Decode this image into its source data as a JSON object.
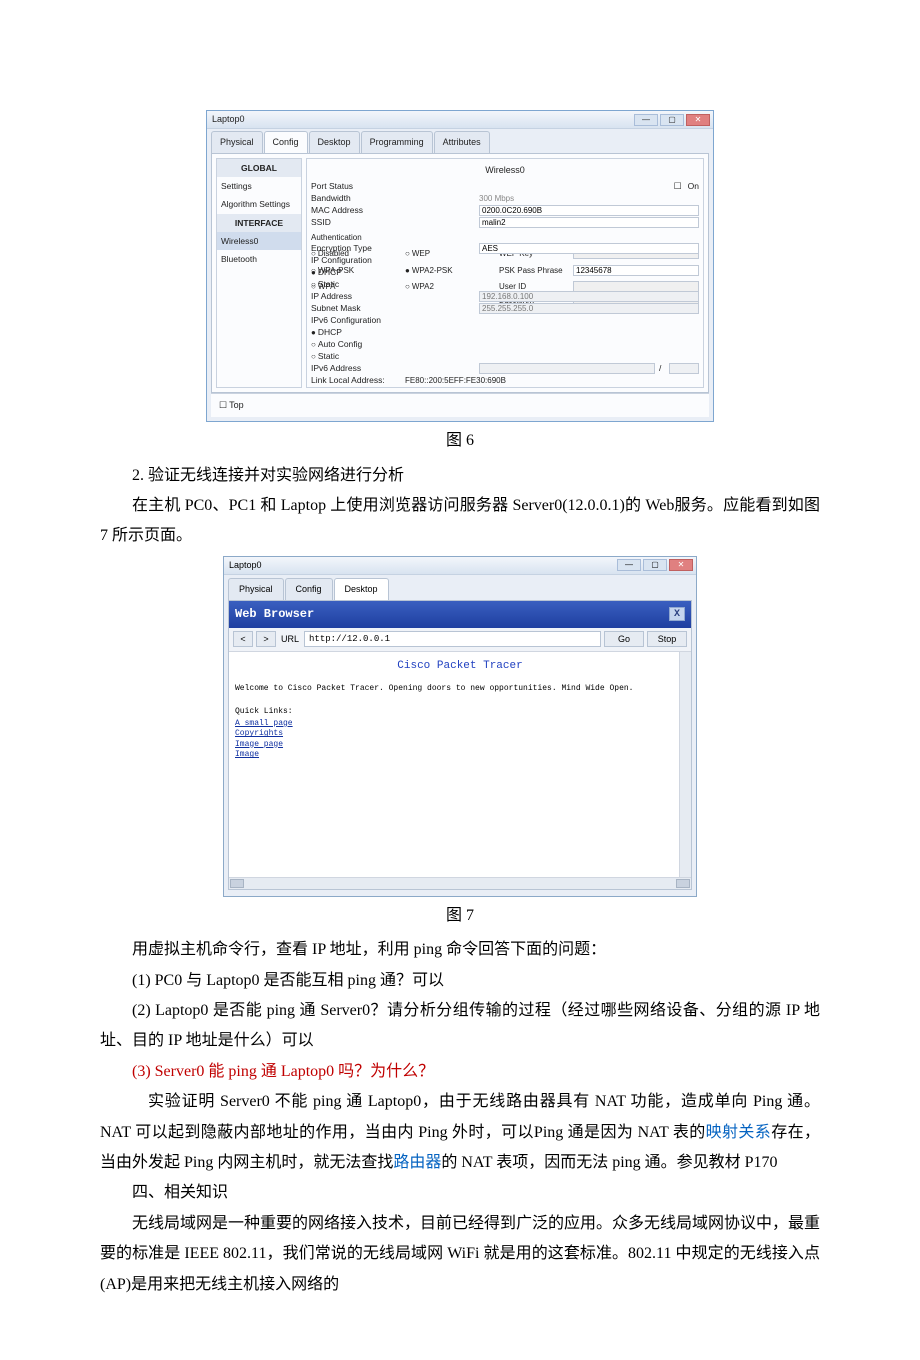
{
  "fig6": {
    "window_title": "Laptop0",
    "tabs": [
      "Physical",
      "Config",
      "Desktop",
      "Programming",
      "Attributes"
    ],
    "active_tab": "Config",
    "sidebar": {
      "cat_global": "GLOBAL",
      "items_global": [
        "Settings",
        "Algorithm Settings"
      ],
      "cat_interface": "INTERFACE",
      "items_interface": [
        "Wireless0",
        "Bluetooth"
      ],
      "selected": "Wireless0"
    },
    "panel": {
      "title": "Wireless0",
      "on_label": "On",
      "port_status": "Port Status",
      "bandwidth_label": "Bandwidth",
      "bandwidth_value": "300 Mbps",
      "mac_label": "MAC Address",
      "mac_value": "0200.0C20.690B",
      "ssid_label": "SSID",
      "ssid_value": "malin2",
      "auth_label": "Authentication",
      "auth_options": {
        "disabled": "Disabled",
        "wpa_psk": "WPA-PSK",
        "wpa": "WPA",
        "wep": "WEP",
        "wpa2_psk": "WPA2-PSK",
        "wpa2": "WPA2"
      },
      "auth_selected": "WPA2-PSK",
      "wep_key_label": "WEP Key",
      "psk_label": "PSK Pass Phrase",
      "psk_value": "12345678",
      "userid_label": "User ID",
      "password_label": "Password",
      "enc_label": "Encryption Type",
      "enc_value": "AES",
      "ipconf_label": "IP Configuration",
      "ipconf_dhcp": "DHCP",
      "ipconf_static": "Static",
      "ip_label": "IP Address",
      "ip_value": "192.168.0.100",
      "mask_label": "Subnet Mask",
      "mask_value": "255.255.255.0",
      "ip6conf_label": "IPv6 Configuration",
      "ip6_dhcp": "DHCP",
      "ip6_auto": "Auto Config",
      "ip6_static": "Static",
      "ip6addr_label": "IPv6 Address",
      "linklocal_label": "Link Local Address:",
      "linklocal_value": "FE80::200:5EFF:FE30:690B"
    },
    "footer": "Top",
    "caption": "图 6"
  },
  "body_text": {
    "p1": "2. 验证无线连接并对实验网络进行分析",
    "p2": "在主机 PC0、PC1 和 Laptop 上使用浏览器访问服务器 Server0(12.0.0.1)的 Web服务。应能看到如图 7 所示页面。"
  },
  "fig7": {
    "window_title": "Laptop0",
    "tabs": [
      "Physical",
      "Config",
      "Desktop"
    ],
    "active_tab": "Desktop",
    "browser_title": "Web Browser",
    "close_x": "X",
    "nav_back": "<",
    "nav_fwd": ">",
    "url_label": "URL",
    "url_value": "http://12.0.0.1",
    "go_label": "Go",
    "stop_label": "Stop",
    "page_title": "Cisco Packet Tracer",
    "welcome": "Welcome to Cisco Packet Tracer. Opening doors to new opportunities. Mind Wide Open.",
    "quick_links_label": "Quick Links:",
    "links": [
      "A small page",
      "Copyrights",
      "Image page",
      "Image"
    ],
    "caption": "图 7"
  },
  "body_text2": {
    "p3": "用虚拟主机命令行，查看 IP 地址，利用 ping 命令回答下面的问题：",
    "p4": "(1) PC0 与 Laptop0 是否能互相 ping 通？可以",
    "p5": "(2) Laptop0 是否能 ping 通 Server0？请分析分组传输的过程（经过哪些网络设备、分组的源 IP 地址、目的 IP 地址是什么）可以",
    "p6": "(3) Server0 能 ping 通 Laptop0 吗？为什么？",
    "p7a": "实验证明 Server0 不能 ping 通 Laptop0，由于无线路由器具有 NAT 功能，造成单向 Ping 通。NAT 可以起到隐蔽内部地址的作用，当由内 Ping 外时，可以Ping 通是因为 NAT 表的",
    "p7_link1": "映射关系",
    "p7b": "存在，当由外发起 Ping 内网主机时，就无法查找",
    "p7_link2": "路由器",
    "p7c": "的 NAT 表项，因而无法 ping 通。参见教材 P170",
    "p8": "四、相关知识",
    "p9": "无线局域网是一种重要的网络接入技术，目前已经得到广泛的应用。众多无线局域网协议中，最重要的标准是 IEEE 802.11，我们常说的无线局域网 WiFi 就是用的这套标准。802.11 中规定的无线接入点(AP)是用来把无线主机接入网络的"
  }
}
